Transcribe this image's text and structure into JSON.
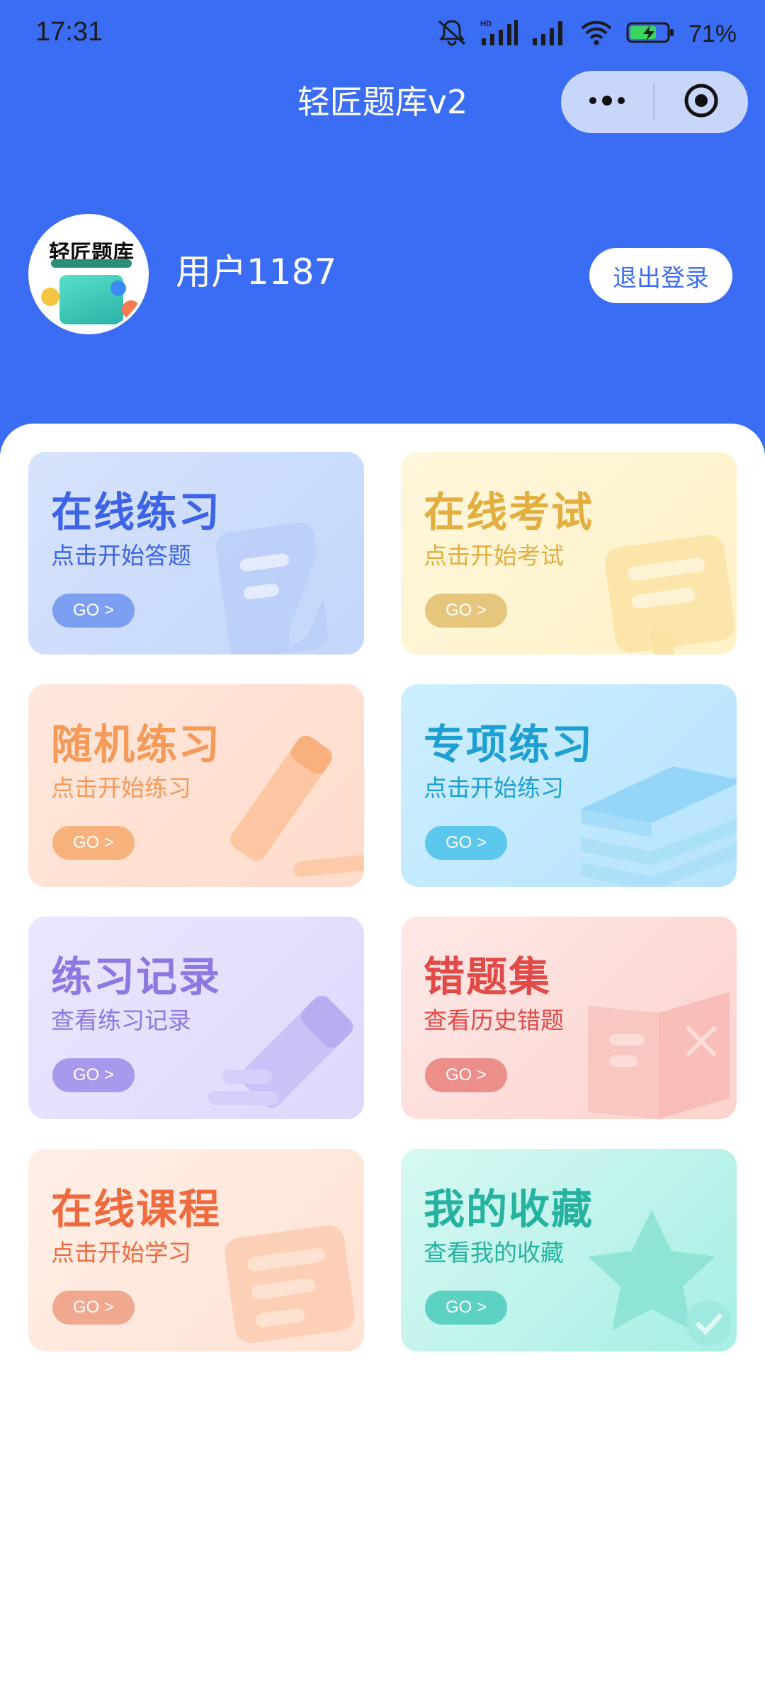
{
  "status_bar": {
    "time": "17:31",
    "battery_percent": "71%",
    "icons": [
      "mute-bell-icon",
      "hd-signal-icon",
      "signal-icon",
      "wifi-icon",
      "battery-charging-icon"
    ]
  },
  "header": {
    "title": "轻匠题库v2",
    "background_color": "#3A6CF4",
    "capsule": {
      "more_icon": "more-dots-icon",
      "close_icon": "target-circle-icon"
    }
  },
  "profile": {
    "avatar_logo_text": "轻匠题库",
    "username": "用户1187",
    "logout_label": "退出登录"
  },
  "cards": [
    {
      "title": "在线练习",
      "subtitle": "点击开始答题",
      "go_label": "GO >",
      "icon": "document-pencil-icon",
      "color": "#3d63e6"
    },
    {
      "title": "在线考试",
      "subtitle": "点击开始考试",
      "go_label": "GO >",
      "icon": "exam-paper-icon",
      "color": "#e2ae40"
    },
    {
      "title": "随机练习",
      "subtitle": "点击开始练习",
      "go_label": "GO >",
      "icon": "pencil-icon",
      "color": "#f59a58"
    },
    {
      "title": "专项练习",
      "subtitle": "点击开始练习",
      "go_label": "GO >",
      "icon": "stacked-books-icon",
      "color": "#1e9fd1"
    },
    {
      "title": "练习记录",
      "subtitle": "查看练习记录",
      "go_label": "GO >",
      "icon": "eraser-icon",
      "color": "#8c78e0"
    },
    {
      "title": "错题集",
      "subtitle": "查看历史错题",
      "go_label": "GO >",
      "icon": "open-book-icon",
      "color": "#e24a48"
    },
    {
      "title": "在线课程",
      "subtitle": "点击开始学习",
      "go_label": "GO >",
      "icon": "course-doc-icon",
      "color": "#ef6a3e"
    },
    {
      "title": "我的收藏",
      "subtitle": "查看我的收藏",
      "go_label": "GO >",
      "icon": "star-check-icon",
      "color": "#25b3a0"
    }
  ]
}
